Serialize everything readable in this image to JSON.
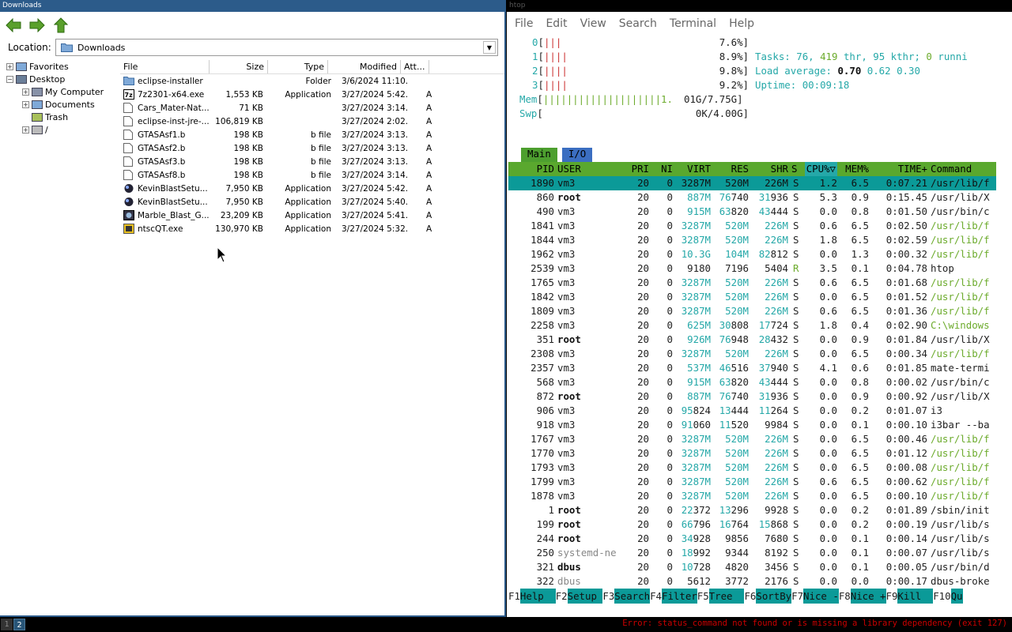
{
  "file_manager": {
    "title": "Downloads",
    "location_label": "Location:",
    "location_value": "Downloads",
    "tree": [
      {
        "label": "Favorites",
        "expander": "+"
      },
      {
        "label": "Desktop",
        "expander": "−"
      },
      {
        "label": "My Computer",
        "expander": "+"
      },
      {
        "label": "Documents",
        "expander": "+"
      },
      {
        "label": "Trash",
        "expander": ""
      },
      {
        "label": "/",
        "expander": "+"
      }
    ],
    "columns": [
      "File",
      "Size",
      "Type",
      "Modified",
      "Att..."
    ],
    "files": [
      {
        "name": "eclipse-installer",
        "size": "",
        "type": "Folder",
        "modified": "3/6/2024 11:10...",
        "att": "",
        "icon": "folder-icon"
      },
      {
        "name": "7z2301-x64.exe",
        "size": "1,553 KB",
        "type": "Application",
        "modified": "3/27/2024 5:42...",
        "att": "A",
        "icon": "7zip-icon"
      },
      {
        "name": "Cars_Mater-Nat...",
        "size": "71 KB",
        "type": "",
        "modified": "3/27/2024 3:14...",
        "att": "A",
        "icon": "document-icon"
      },
      {
        "name": "eclipse-inst-jre-...",
        "size": "106,819 KB",
        "type": "",
        "modified": "3/27/2024 2:02...",
        "att": "A",
        "icon": "document-icon"
      },
      {
        "name": "GTASAsf1.b",
        "size": "198 KB",
        "type": "b file",
        "modified": "3/27/2024 3:13...",
        "att": "A",
        "icon": "document-icon"
      },
      {
        "name": "GTASAsf2.b",
        "size": "198 KB",
        "type": "b file",
        "modified": "3/27/2024 3:13...",
        "att": "A",
        "icon": "document-icon"
      },
      {
        "name": "GTASAsf3.b",
        "size": "198 KB",
        "type": "b file",
        "modified": "3/27/2024 3:13...",
        "att": "A",
        "icon": "document-icon"
      },
      {
        "name": "GTASAsf8.b",
        "size": "198 KB",
        "type": "b file",
        "modified": "3/27/2024 3:14...",
        "att": "A",
        "icon": "document-icon"
      },
      {
        "name": "KevinBlastSetu...",
        "size": "7,950 KB",
        "type": "Application",
        "modified": "3/27/2024 5:42...",
        "att": "A",
        "icon": "marble-icon"
      },
      {
        "name": "KevinBlastSetu...",
        "size": "7,950 KB",
        "type": "Application",
        "modified": "3/27/2024 5:40...",
        "att": "A",
        "icon": "marble-icon"
      },
      {
        "name": "Marble_Blast_G...",
        "size": "23,209 KB",
        "type": "Application",
        "modified": "3/27/2024 5:41...",
        "att": "A",
        "icon": "game-icon"
      },
      {
        "name": "ntscQT.exe",
        "size": "130,970 KB",
        "type": "Application",
        "modified": "3/27/2024 5:32...",
        "att": "A",
        "icon": "app-icon"
      }
    ]
  },
  "terminal": {
    "title": "htop",
    "menu": [
      "File",
      "Edit",
      "View",
      "Search",
      "Terminal",
      "Help"
    ],
    "cpus": [
      {
        "id": "0",
        "bars": "|||",
        "pct": "7.6%]"
      },
      {
        "id": "1",
        "bars": "||||",
        "pct": "8.9%]"
      },
      {
        "id": "2",
        "bars": "||||",
        "pct": "9.8%]"
      },
      {
        "id": "3",
        "bars": "||||",
        "pct": "9.2%]"
      }
    ],
    "mem": {
      "label": "Mem",
      "bars": "||||||||||||||||||||1.",
      "value": "01G/7.75G]"
    },
    "swp": {
      "label": "Swp",
      "value": "0K/4.00G]"
    },
    "tasks": {
      "label": "Tasks:",
      "tasks": "76",
      "thr": "419",
      "thr_label": "thr,",
      "kthr": "95",
      "kthr_label": "kthr;",
      "running": "0",
      "running_label": "runni"
    },
    "load": {
      "label": "Load average:",
      "l1": "0.70",
      "l5": "0.62",
      "l15": "0.30"
    },
    "uptime": {
      "label": "Uptime:",
      "value": "00:09:18"
    },
    "tabs": [
      "Main",
      "I/O"
    ],
    "header": [
      "PID",
      "USER",
      "PRI",
      "NI",
      "VIRT",
      "RES",
      "SHR",
      "S",
      "CPU%▽",
      "MEM%",
      "TIME+",
      "Command"
    ],
    "processes": [
      [
        "1890",
        "vm3",
        "20",
        "0",
        "3287M",
        "520M",
        "226M",
        "S",
        "1.2",
        "6.5",
        "0:07.21",
        "/usr/lib/f"
      ],
      [
        "860",
        "root",
        "20",
        "0",
        "887M",
        "76740",
        "31936",
        "S",
        "5.3",
        "0.9",
        "0:15.45",
        "/usr/lib/X"
      ],
      [
        "490",
        "vm3",
        "20",
        "0",
        "915M",
        "63820",
        "43444",
        "S",
        "0.0",
        "0.8",
        "0:01.50",
        "/usr/bin/c"
      ],
      [
        "1841",
        "vm3",
        "20",
        "0",
        "3287M",
        "520M",
        "226M",
        "S",
        "0.6",
        "6.5",
        "0:02.50",
        "/usr/lib/f"
      ],
      [
        "1844",
        "vm3",
        "20",
        "0",
        "3287M",
        "520M",
        "226M",
        "S",
        "1.8",
        "6.5",
        "0:02.59",
        "/usr/lib/f"
      ],
      [
        "1962",
        "vm3",
        "20",
        "0",
        "10.3G",
        "104M",
        "82812",
        "S",
        "0.0",
        "1.3",
        "0:00.32",
        "/usr/lib/f"
      ],
      [
        "2539",
        "vm3",
        "20",
        "0",
        "9180",
        "7196",
        "5404",
        "R",
        "3.5",
        "0.1",
        "0:04.78",
        "htop"
      ],
      [
        "1765",
        "vm3",
        "20",
        "0",
        "3287M",
        "520M",
        "226M",
        "S",
        "0.6",
        "6.5",
        "0:01.68",
        "/usr/lib/f"
      ],
      [
        "1842",
        "vm3",
        "20",
        "0",
        "3287M",
        "520M",
        "226M",
        "S",
        "0.0",
        "6.5",
        "0:01.52",
        "/usr/lib/f"
      ],
      [
        "1809",
        "vm3",
        "20",
        "0",
        "3287M",
        "520M",
        "226M",
        "S",
        "0.6",
        "6.5",
        "0:01.36",
        "/usr/lib/f"
      ],
      [
        "2258",
        "vm3",
        "20",
        "0",
        "625M",
        "30808",
        "17724",
        "S",
        "1.8",
        "0.4",
        "0:02.90",
        "C:\\windows"
      ],
      [
        "351",
        "root",
        "20",
        "0",
        "926M",
        "76948",
        "28432",
        "S",
        "0.0",
        "0.9",
        "0:01.84",
        "/usr/lib/X"
      ],
      [
        "2308",
        "vm3",
        "20",
        "0",
        "3287M",
        "520M",
        "226M",
        "S",
        "0.0",
        "6.5",
        "0:00.34",
        "/usr/lib/f"
      ],
      [
        "2357",
        "vm3",
        "20",
        "0",
        "537M",
        "46516",
        "37940",
        "S",
        "4.1",
        "0.6",
        "0:01.85",
        "mate-termi"
      ],
      [
        "568",
        "vm3",
        "20",
        "0",
        "915M",
        "63820",
        "43444",
        "S",
        "0.0",
        "0.8",
        "0:00.02",
        "/usr/bin/c"
      ],
      [
        "872",
        "root",
        "20",
        "0",
        "887M",
        "76740",
        "31936",
        "S",
        "0.0",
        "0.9",
        "0:00.92",
        "/usr/lib/X"
      ],
      [
        "906",
        "vm3",
        "20",
        "0",
        "95824",
        "13444",
        "11264",
        "S",
        "0.0",
        "0.2",
        "0:01.07",
        "i3"
      ],
      [
        "918",
        "vm3",
        "20",
        "0",
        "91060",
        "11520",
        "9984",
        "S",
        "0.0",
        "0.1",
        "0:00.10",
        "i3bar --ba"
      ],
      [
        "1767",
        "vm3",
        "20",
        "0",
        "3287M",
        "520M",
        "226M",
        "S",
        "0.0",
        "6.5",
        "0:00.46",
        "/usr/lib/f"
      ],
      [
        "1770",
        "vm3",
        "20",
        "0",
        "3287M",
        "520M",
        "226M",
        "S",
        "0.0",
        "6.5",
        "0:01.12",
        "/usr/lib/f"
      ],
      [
        "1793",
        "vm3",
        "20",
        "0",
        "3287M",
        "520M",
        "226M",
        "S",
        "0.0",
        "6.5",
        "0:00.08",
        "/usr/lib/f"
      ],
      [
        "1799",
        "vm3",
        "20",
        "0",
        "3287M",
        "520M",
        "226M",
        "S",
        "0.6",
        "6.5",
        "0:00.62",
        "/usr/lib/f"
      ],
      [
        "1878",
        "vm3",
        "20",
        "0",
        "3287M",
        "520M",
        "226M",
        "S",
        "0.0",
        "6.5",
        "0:00.10",
        "/usr/lib/f"
      ],
      [
        "1",
        "root",
        "20",
        "0",
        "22372",
        "13296",
        "9928",
        "S",
        "0.0",
        "0.2",
        "0:01.89",
        "/sbin/init"
      ],
      [
        "199",
        "root",
        "20",
        "0",
        "66796",
        "16764",
        "15868",
        "S",
        "0.0",
        "0.2",
        "0:00.19",
        "/usr/lib/s"
      ],
      [
        "244",
        "root",
        "20",
        "0",
        "34928",
        "9856",
        "7680",
        "S",
        "0.0",
        "0.1",
        "0:00.14",
        "/usr/lib/s"
      ],
      [
        "250",
        "systemd-ne",
        "20",
        "0",
        "18992",
        "9344",
        "8192",
        "S",
        "0.0",
        "0.1",
        "0:00.07",
        "/usr/lib/s"
      ],
      [
        "321",
        "dbus",
        "20",
        "0",
        "10728",
        "4820",
        "3456",
        "S",
        "0.0",
        "0.1",
        "0:00.05",
        "/usr/bin/d"
      ],
      [
        "322",
        "dbus",
        "20",
        "0",
        "5612",
        "3772",
        "2176",
        "S",
        "0.0",
        "0.0",
        "0:00.17",
        "dbus-broke"
      ]
    ],
    "fkeys": [
      {
        "key": "F1",
        "label": "Help  "
      },
      {
        "key": "F2",
        "label": "Setup "
      },
      {
        "key": "F3",
        "label": "Search"
      },
      {
        "key": "F4",
        "label": "Filter"
      },
      {
        "key": "F5",
        "label": "Tree  "
      },
      {
        "key": "F6",
        "label": "SortBy"
      },
      {
        "key": "F7",
        "label": "Nice -"
      },
      {
        "key": "F8",
        "label": "Nice +"
      },
      {
        "key": "F9",
        "label": "Kill  "
      },
      {
        "key": "F10",
        "label": "Qu"
      }
    ]
  },
  "statusbar": {
    "workspaces": [
      "1",
      "2"
    ],
    "active_workspace": "2",
    "error": "Error: status_command not found or is missing a library dependency (exit 127)"
  },
  "colors": {
    "title_bar": "#2c5b8a",
    "htop_header": "#5aa82e",
    "htop_highlight": "#0b9a98",
    "error": "#cc0000"
  }
}
